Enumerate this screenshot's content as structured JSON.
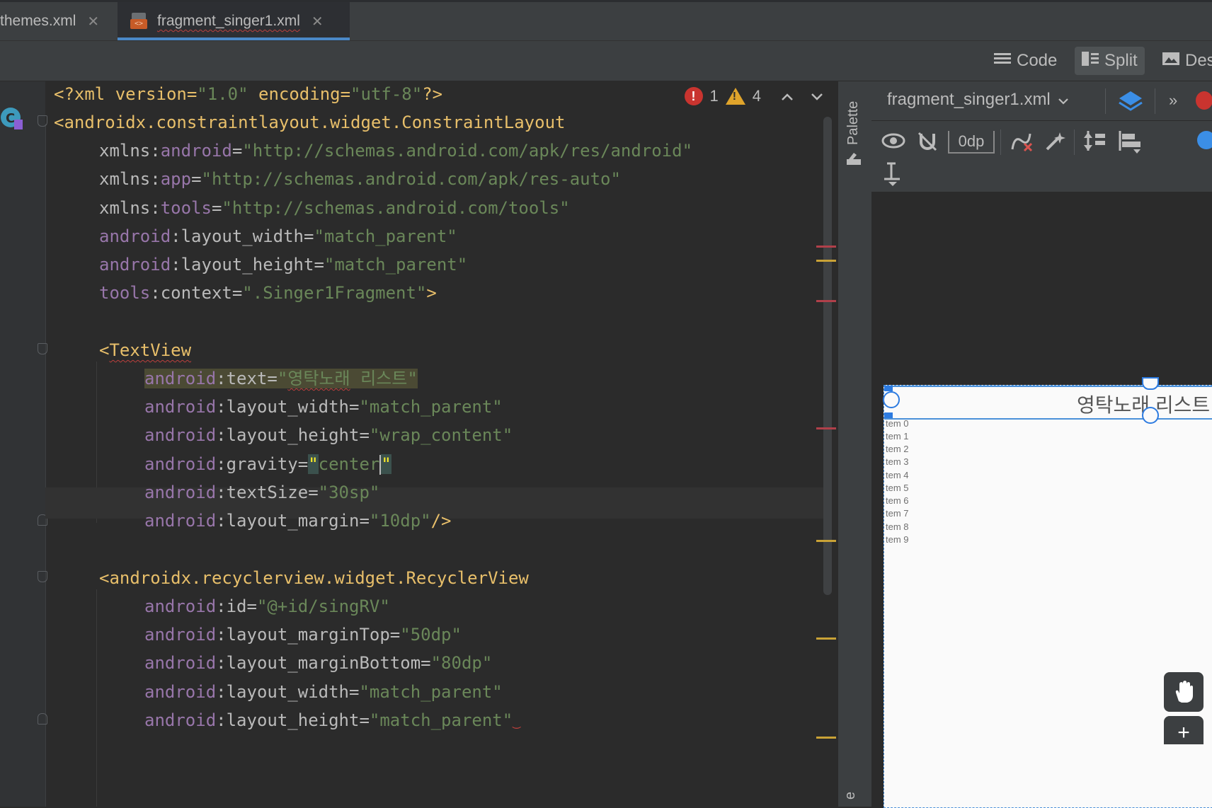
{
  "tabs": [
    {
      "label": "themes.xml",
      "close": "✕"
    },
    {
      "label": "fragment_singer1.xml",
      "close": "✕"
    }
  ],
  "toolbar": {
    "code_label": "Code",
    "split_label": "Split",
    "design_label": "Des"
  },
  "inspections": {
    "errors": "1",
    "warnings": "4"
  },
  "code": {
    "l1_a": "<?xml version=",
    "l1_b": "\"1.0\"",
    "l1_c": " encoding=",
    "l1_d": "\"utf-8\"",
    "l1_e": "?>",
    "l2_tag": "<androidx.constraintlayout.widget.ConstraintLayout",
    "l3_attr": "xmlns:",
    "l3_ns": "android",
    "l3_val": "\"http://schemas.android.com/apk/res/android\"",
    "l4_attr": "xmlns:",
    "l4_ns": "app",
    "l4_val": "\"http://schemas.android.com/apk/res-auto\"",
    "l5_attr": "xmlns:",
    "l5_ns": "tools",
    "l5_val": "\"http://schemas.android.com/tools\"",
    "l6_ns": "android",
    "l6_attr": ":layout_width",
    "l6_val": "\"match_parent\"",
    "l7_ns": "android",
    "l7_attr": ":layout_height",
    "l7_val": "\"match_parent\"",
    "l8_ns": "tools",
    "l8_attr": ":context",
    "l8_val": "\".Singer1Fragment\"",
    "l8_end": ">",
    "l10_lt": "<",
    "l10_tag": "TextView",
    "l11_ns": "android",
    "l11_attr": ":text",
    "l11_q1": "\"",
    "l11_val": "영탁노래",
    "l11_rest": " 리스트\"",
    "l12_ns": "android",
    "l12_attr": ":layout_width",
    "l12_val": "\"match_parent\"",
    "l13_ns": "android",
    "l13_attr": ":layout_height",
    "l13_val": "\"wrap_content\"",
    "l14_ns": "android",
    "l14_attr": ":gravity",
    "l14_q1": "\"",
    "l14_val": "center",
    "l14_q2": "\"",
    "l15_ns": "android",
    "l15_attr": ":textSize",
    "l15_val": "\"30sp\"",
    "l16_ns": "android",
    "l16_attr": ":layout_margin",
    "l16_val": "\"10dp\"",
    "l16_end": "/>",
    "l18_tag": "<androidx.recyclerview.widget.RecyclerView",
    "l19_ns": "android",
    "l19_attr": ":id",
    "l19_val": "\"@+id/singRV\"",
    "l20_ns": "android",
    "l20_attr": ":layout_marginTop",
    "l20_val": "\"50dp\"",
    "l21_ns": "android",
    "l21_attr": ":layout_marginBottom",
    "l21_val": "\"80dp\"",
    "l22_ns": "android",
    "l22_attr": ":layout_width",
    "l22_val": "\"match_parent\"",
    "l23_ns": "android",
    "l23_attr": ":layout_height",
    "l23_val": "\"match_parent\""
  },
  "palette_label": "Palette",
  "design": {
    "file_label": "fragment_singer1.xml",
    "margin_value": "0dp",
    "preview_title": "영탁노래 리스트",
    "items": [
      "tem 0",
      "tem 1",
      "tem 2",
      "tem 3",
      "tem 4",
      "tem 5",
      "tem 6",
      "tem 7",
      "tem 8",
      "tem 9"
    ],
    "plus_label": "+",
    "bottom_strip_label": "e"
  },
  "colors": {
    "accent": "#4a88c7",
    "error": "#c9342f",
    "warning": "#e0a42b",
    "tag": "#e8bf6a",
    "string": "#6a8759",
    "namespace": "#9876aa"
  }
}
